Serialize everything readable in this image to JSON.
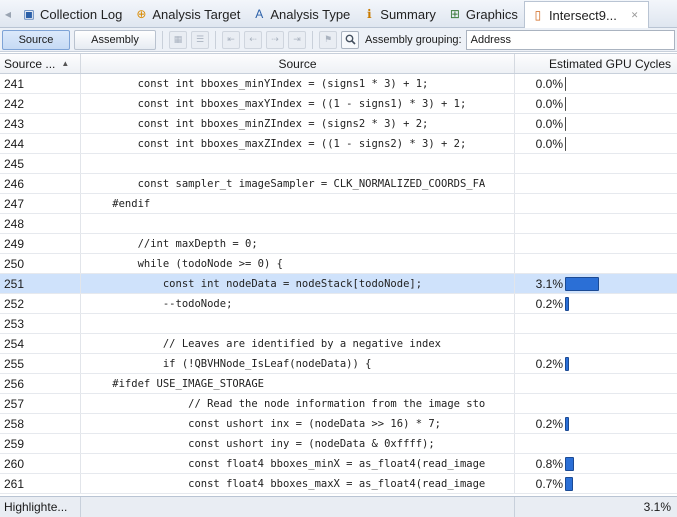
{
  "tabs": [
    {
      "label": "Collection Log",
      "icon": "log-icon",
      "glyph": "▣",
      "color": "#2a5fa8"
    },
    {
      "label": "Analysis Target",
      "icon": "target-icon",
      "glyph": "⊕",
      "color": "#d98a00"
    },
    {
      "label": "Analysis Type",
      "icon": "analysis-type-icon",
      "glyph": "A",
      "color": "#2a5fa8"
    },
    {
      "label": "Summary",
      "icon": "summary-icon",
      "glyph": "ℹ",
      "color": "#c87a00"
    },
    {
      "label": "Graphics",
      "icon": "graphics-icon",
      "glyph": "⊞",
      "color": "#3a7a3a"
    },
    {
      "label": "Intersect9...",
      "icon": "source-file-icon",
      "glyph": "▯",
      "color": "#d0661a",
      "active": true
    }
  ],
  "toolbar": {
    "source_label": "Source",
    "assembly_label": "Assembly",
    "grouping_label": "Assembly grouping:",
    "grouping_value": "Address"
  },
  "columns": {
    "line": "Source ...",
    "source": "Source",
    "gpu": "Estimated GPU Cycles"
  },
  "rows": [
    {
      "line": "241",
      "code": "        const int bboxes_minYIndex = (signs1 * 3) + 1;",
      "pct": "0.0%",
      "value": 0.0
    },
    {
      "line": "242",
      "code": "        const int bboxes_maxYIndex = ((1 - signs1) * 3) + 1;",
      "pct": "0.0%",
      "value": 0.0
    },
    {
      "line": "243",
      "code": "        const int bboxes_minZIndex = (signs2 * 3) + 2;",
      "pct": "0.0%",
      "value": 0.0
    },
    {
      "line": "244",
      "code": "        const int bboxes_maxZIndex = ((1 - signs2) * 3) + 2;",
      "pct": "0.0%",
      "value": 0.0
    },
    {
      "line": "245",
      "code": "",
      "pct": "",
      "value": null
    },
    {
      "line": "246",
      "code": "        const sampler_t imageSampler = CLK_NORMALIZED_COORDS_FA",
      "pct": "",
      "value": null
    },
    {
      "line": "247",
      "code": "    #endif",
      "pct": "",
      "value": null
    },
    {
      "line": "248",
      "code": "",
      "pct": "",
      "value": null
    },
    {
      "line": "249",
      "code": "        //int maxDepth = 0;",
      "pct": "",
      "value": null
    },
    {
      "line": "250",
      "code": "        while (todoNode >= 0) {",
      "pct": "",
      "value": null
    },
    {
      "line": "251",
      "code": "            const int nodeData = nodeStack[todoNode];",
      "pct": "3.1%",
      "value": 3.1,
      "selected": true
    },
    {
      "line": "252",
      "code": "            --todoNode;",
      "pct": "0.2%",
      "value": 0.2
    },
    {
      "line": "253",
      "code": "",
      "pct": "",
      "value": null
    },
    {
      "line": "254",
      "code": "            // Leaves are identified by a negative index",
      "pct": "",
      "value": null
    },
    {
      "line": "255",
      "code": "            if (!QBVHNode_IsLeaf(nodeData)) {",
      "pct": "0.2%",
      "value": 0.2
    },
    {
      "line": "256",
      "code": "    #ifdef USE_IMAGE_STORAGE",
      "pct": "",
      "value": null
    },
    {
      "line": "257",
      "code": "                // Read the node information from the image sto",
      "pct": "",
      "value": null
    },
    {
      "line": "258",
      "code": "                const ushort inx = (nodeData >> 16) * 7;",
      "pct": "0.2%",
      "value": 0.2
    },
    {
      "line": "259",
      "code": "                const ushort iny = (nodeData & 0xffff);",
      "pct": "",
      "value": null
    },
    {
      "line": "260",
      "code": "                const float4 bboxes_minX = as_float4(read_image",
      "pct": "0.8%",
      "value": 0.8
    },
    {
      "line": "261",
      "code": "                const float4 bboxes_maxX = as_float4(read_image",
      "pct": "0.7%",
      "value": 0.7
    }
  ],
  "footer": {
    "label": "Highlighte...",
    "total": "3.1%"
  }
}
